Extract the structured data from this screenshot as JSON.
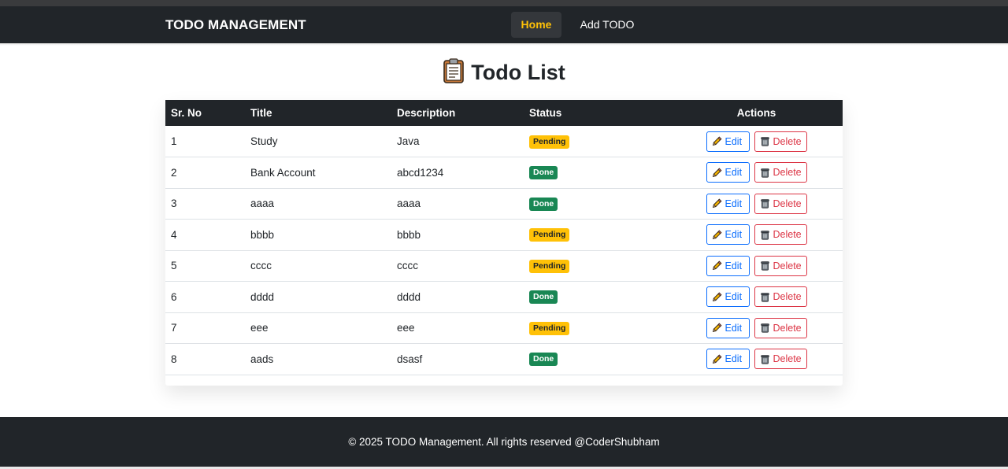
{
  "nav": {
    "brand": "TODO MANAGEMENT",
    "home": "Home",
    "add": "Add TODO"
  },
  "page": {
    "title": "Todo List",
    "title_icon": "clipboard-icon"
  },
  "table": {
    "headers": [
      "Sr. No",
      "Title",
      "Description",
      "Status",
      "Actions"
    ],
    "rows": [
      {
        "no": "1",
        "title": "Study",
        "description": "Java",
        "status": "Pending"
      },
      {
        "no": "2",
        "title": "Bank Account",
        "description": "abcd1234",
        "status": "Done"
      },
      {
        "no": "3",
        "title": "aaaa",
        "description": "aaaa",
        "status": "Done"
      },
      {
        "no": "4",
        "title": "bbbb",
        "description": "bbbb",
        "status": "Pending"
      },
      {
        "no": "5",
        "title": "cccc",
        "description": "cccc",
        "status": "Pending"
      },
      {
        "no": "6",
        "title": "dddd",
        "description": "dddd",
        "status": "Done"
      },
      {
        "no": "7",
        "title": "eee",
        "description": "eee",
        "status": "Pending"
      },
      {
        "no": "8",
        "title": "aads",
        "description": "dsasf",
        "status": "Done"
      }
    ],
    "edit_label": "Edit",
    "delete_label": "Delete",
    "edit_icon": "pencil-icon",
    "delete_icon": "trash-icon"
  },
  "footer": {
    "text": "© 2025 TODO Management. All rights reserved @CoderShubham"
  },
  "colors": {
    "navbar": "#212529",
    "accent_active": "#ffc107",
    "pending": "#ffc107",
    "done": "#198754",
    "edit": "#0d6efd",
    "delete": "#dc3545"
  }
}
